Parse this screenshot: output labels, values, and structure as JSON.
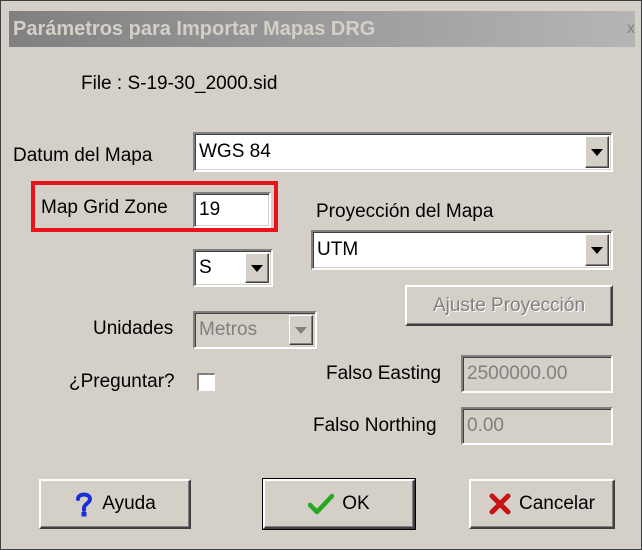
{
  "window": {
    "title": "Parámetros para Importar Mapas DRG",
    "close_glyph": "x"
  },
  "file_label": "File : S-19-30_2000.sid",
  "datum": {
    "label": "Datum del Mapa",
    "value": "WGS 84"
  },
  "grid_zone": {
    "label": "Map Grid Zone",
    "value": "19",
    "hemisphere": "S",
    "highlight_color": "#e8141c"
  },
  "projection": {
    "label": "Proyección del Mapa",
    "value": "UTM",
    "adjust_button": "Ajuste Proyección"
  },
  "units": {
    "label": "Unidades",
    "value": "Metros"
  },
  "ask": {
    "label": "¿Preguntar?",
    "checked": false
  },
  "false_easting": {
    "label": "Falso Easting",
    "value": "2500000.00"
  },
  "false_northing": {
    "label": "Falso Northing",
    "value": "0.00"
  },
  "buttons": {
    "help": {
      "label": "Ayuda",
      "icon": "question-icon",
      "color": "#1a2fd6"
    },
    "ok": {
      "label": "OK",
      "icon": "checkmark-icon",
      "color": "#22a822"
    },
    "cancel": {
      "label": "Cancelar",
      "icon": "x-mark-icon",
      "color": "#c81414"
    }
  }
}
